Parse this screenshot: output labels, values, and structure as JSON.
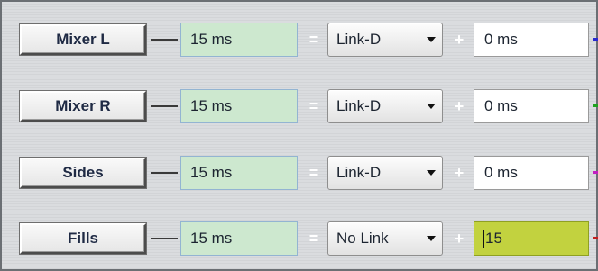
{
  "rows": [
    {
      "name": "Mixer L",
      "delay": "15 ms",
      "link": "Link-D",
      "offset": "0 ms",
      "offset_active": false,
      "edge_color": "#2a2ad0"
    },
    {
      "name": "Mixer R",
      "delay": "15 ms",
      "link": "Link-D",
      "offset": "0 ms",
      "offset_active": false,
      "edge_color": "#1fa31f"
    },
    {
      "name": "Sides",
      "delay": "15 ms",
      "link": "Link-D",
      "offset": "0 ms",
      "offset_active": false,
      "edge_color": "#c21fc2"
    },
    {
      "name": "Fills",
      "delay": "15 ms",
      "link": "No Link",
      "offset": "15",
      "offset_active": true,
      "edge_color": "#c21f1f"
    }
  ],
  "operators": {
    "equals": "=",
    "plus": "+"
  },
  "colors": {
    "delay_bg": "#cde8cf",
    "active_offset_bg": "#c2d23f",
    "panel_bg": "#dadcdf"
  },
  "icons": {
    "dropdown": "chevron-down-icon"
  }
}
